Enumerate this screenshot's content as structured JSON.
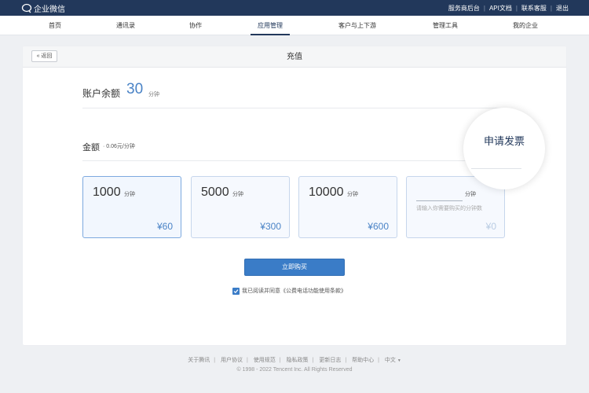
{
  "topbar": {
    "brand": "企业微信",
    "links": [
      "服务商后台",
      "API文档",
      "联系客服",
      "退出"
    ]
  },
  "nav": {
    "items": [
      "首页",
      "通讯录",
      "协作",
      "应用管理",
      "客户与上下游",
      "管理工具",
      "我的企业"
    ],
    "active_index": 3
  },
  "page": {
    "back_label": "返回",
    "title": "充值"
  },
  "balance": {
    "label": "账户余额",
    "value": "30",
    "unit": "分钟"
  },
  "amount": {
    "label": "金额",
    "price_note": "· 0.06元/分钟"
  },
  "options": [
    {
      "qty": "1000",
      "unit": "分钟",
      "price": "¥60",
      "selected": true
    },
    {
      "qty": "5000",
      "unit": "分钟",
      "price": "¥300",
      "selected": false
    },
    {
      "qty": "10000",
      "unit": "分钟",
      "price": "¥600",
      "selected": false
    }
  ],
  "custom_option": {
    "value": "",
    "unit": "分钟",
    "placeholder": "请输入你需要购买的分钟数",
    "price": "¥0"
  },
  "invoice": {
    "label": "申请发票"
  },
  "buy_button": "立即购买",
  "agreement": {
    "checked": true,
    "text": "我已阅读并同意《公费电话功能使用条款》"
  },
  "footer": {
    "links": [
      "关于腾讯",
      "用户协议",
      "使用规范",
      "隐私政策",
      "更新日志",
      "帮助中心",
      "中文"
    ],
    "language_arrow": "▼",
    "copyright": "© 1998 - 2022 Tencent Inc. All Rights Reserved"
  },
  "colors": {
    "topbar": "#22385b",
    "accent": "#3a7cc7",
    "value_blue": "#4a83c6"
  },
  "icons": {
    "brand": "wechat-work-logo-icon",
    "back": "double-chevron-left-icon",
    "checkbox": "checkmark-icon"
  }
}
